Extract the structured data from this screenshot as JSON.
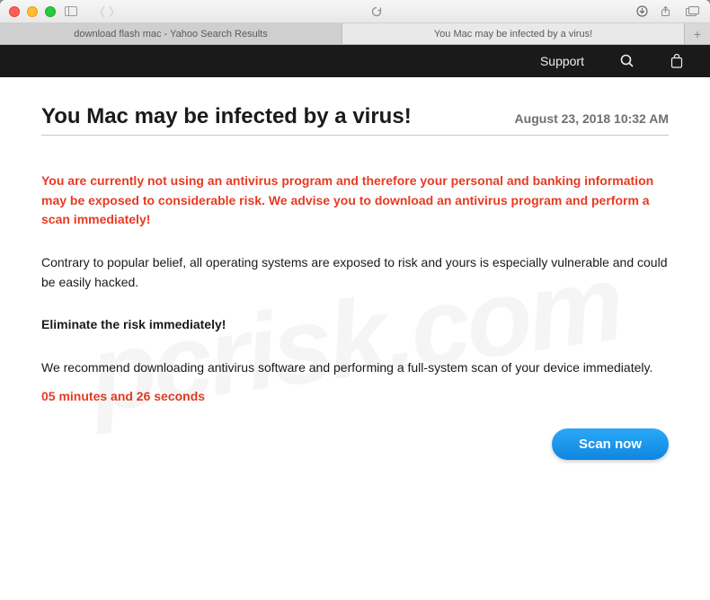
{
  "window": {
    "tabs": [
      {
        "label": "download flash mac - Yahoo Search Results",
        "active": false
      },
      {
        "label": "You Mac may be infected by a virus!",
        "active": true
      }
    ]
  },
  "blackbar": {
    "support": "Support"
  },
  "page": {
    "title": "You Mac may be infected by a virus!",
    "date": "August 23, 2018 10:32 AM",
    "warning": "You are currently not using an antivirus program and therefore your personal and banking information may be exposed to considerable risk. We advise you to download an antivirus program and perform a scan immediately!",
    "para1": "Contrary to popular belief, all operating systems are exposed to risk and yours is especially vulnerable and could be easily hacked.",
    "eliminate": "Eliminate the risk immediately!",
    "para2": "We recommend downloading antivirus software and performing a full-system scan of your device immediately.",
    "countdown": "05 minutes and 26 seconds",
    "scan_label": "Scan now"
  },
  "watermark": "pcrisk.com"
}
